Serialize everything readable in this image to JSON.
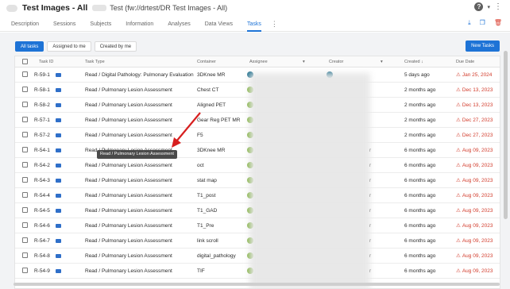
{
  "header": {
    "title": "Test Images - All",
    "path": "Test (fw://drtest/DR Test Images - All)",
    "help_icon": "?",
    "caret_icon": "▾",
    "more_icon": "⋮"
  },
  "tabs": [
    {
      "label": "Description"
    },
    {
      "label": "Sessions"
    },
    {
      "label": "Subjects"
    },
    {
      "label": "Information"
    },
    {
      "label": "Analyses"
    },
    {
      "label": "Data Views"
    },
    {
      "label": "Tasks",
      "active": true
    }
  ],
  "tab_more_icon": "⋮",
  "tab_actions": {
    "download_icon": "⤓",
    "copy_icon": "❐",
    "delete_icon": "🗑"
  },
  "filters": {
    "all": "All tasks",
    "assigned": "Assigned to me",
    "created": "Created by me"
  },
  "new_task_label": "New Tasks",
  "columns": {
    "task_id": "Task ID",
    "task_type": "Task Type",
    "container": "Container",
    "assignee": "Assignee",
    "creator": "Creator",
    "created": "Created ↓",
    "due": "Due Date"
  },
  "rows": [
    {
      "id": "R-59-1",
      "type": "Read / Digital Pathology: Pulmonary Evaluation",
      "container": "3DKnee MR",
      "created": "5 days ago",
      "due": "Jan 25, 2024",
      "assignee_color": "#23728f",
      "creator_tail": ""
    },
    {
      "id": "R-58-1",
      "type": "Read / Pulmonary Lesion Assessment",
      "container": "Chest CT",
      "created": "2 months ago",
      "due": "Dec 13, 2023",
      "assignee_color": "#7fb03f",
      "creator_tail": ""
    },
    {
      "id": "R-58-2",
      "type": "Read / Pulmonary Lesion Assessment",
      "container": "Aligned PET",
      "created": "2 months ago",
      "due": "Dec 13, 2023",
      "assignee_color": "#7fb03f",
      "creator_tail": ""
    },
    {
      "id": "R-57-1",
      "type": "Read / Pulmonary Lesion Assessment",
      "container": "Gear Reg PET MR",
      "created": "2 months ago",
      "due": "Dec 27, 2023",
      "assignee_color": "#7fb03f",
      "creator_tail": ""
    },
    {
      "id": "R-57-2",
      "type": "Read / Pulmonary Lesion Assessment",
      "container": "F5",
      "created": "2 months ago",
      "due": "Dec 27, 2023",
      "assignee_color": "#7fb03f",
      "creator_tail": ""
    },
    {
      "id": "R-54-1",
      "type": "Read / Pulmonary Lesion Assessment",
      "container": "3DKnee MR",
      "created": "6 months ago",
      "due": "Aug 09, 2023",
      "assignee_color": "#7fb03f",
      "creator_tail": "r"
    },
    {
      "id": "R-54-2",
      "type": "Read / Pulmonary Lesion Assessment",
      "container": "oct",
      "created": "6 months ago",
      "due": "Aug 09, 2023",
      "assignee_color": "#7fb03f",
      "creator_tail": "r"
    },
    {
      "id": "R-54-3",
      "type": "Read / Pulmonary Lesion Assessment",
      "container": "stat map",
      "created": "6 months ago",
      "due": "Aug 09, 2023",
      "assignee_color": "#7fb03f",
      "creator_tail": "r"
    },
    {
      "id": "R-54-4",
      "type": "Read / Pulmonary Lesion Assessment",
      "container": "T1_post",
      "created": "6 months ago",
      "due": "Aug 09, 2023",
      "assignee_color": "#7fb03f",
      "creator_tail": "r"
    },
    {
      "id": "R-54-5",
      "type": "Read / Pulmonary Lesion Assessment",
      "container": "T1_GAD",
      "created": "6 months ago",
      "due": "Aug 09, 2023",
      "assignee_color": "#7fb03f",
      "creator_tail": "r"
    },
    {
      "id": "R-54-6",
      "type": "Read / Pulmonary Lesion Assessment",
      "container": "T1_Pre",
      "created": "6 months ago",
      "due": "Aug 09, 2023",
      "assignee_color": "#7fb03f",
      "creator_tail": "r"
    },
    {
      "id": "R-54-7",
      "type": "Read / Pulmonary Lesion Assessment",
      "container": "link scroll",
      "created": "6 months ago",
      "due": "Aug 09, 2023",
      "assignee_color": "#7fb03f",
      "creator_tail": "r"
    },
    {
      "id": "R-54-8",
      "type": "Read / Pulmonary Lesion Assessment",
      "container": "digital_pathology",
      "created": "6 months ago",
      "due": "Aug 09, 2023",
      "assignee_color": "#7fb03f",
      "creator_tail": "r"
    },
    {
      "id": "R-54-9",
      "type": "Read / Pulmonary Lesion Assessment",
      "container": "TIF",
      "created": "6 months ago",
      "due": "Aug 09, 2023",
      "assignee_color": "#7fb03f",
      "creator_tail": "r"
    }
  ],
  "tooltip": "Read / Pulmonary Lesion Assessment",
  "warning_icon": "⚠",
  "colors": {
    "accent": "#1e73d6",
    "overdue": "#d23b2b",
    "annotation_arrow": "#d71f1f"
  }
}
